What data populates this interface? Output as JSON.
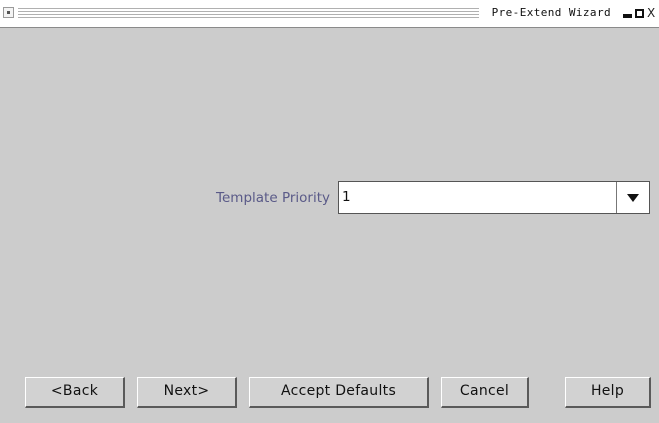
{
  "window": {
    "title": "Pre-Extend Wizard",
    "controls": [
      "minimize-icon",
      "maximize-icon",
      "close-icon"
    ],
    "close_glyph": "X"
  },
  "form": {
    "template_priority": {
      "label": "Template Priority",
      "value": "1"
    }
  },
  "buttons": {
    "back": "<Back",
    "next": "Next>",
    "accept_defaults": "Accept Defaults",
    "cancel": "Cancel",
    "help": "Help"
  }
}
